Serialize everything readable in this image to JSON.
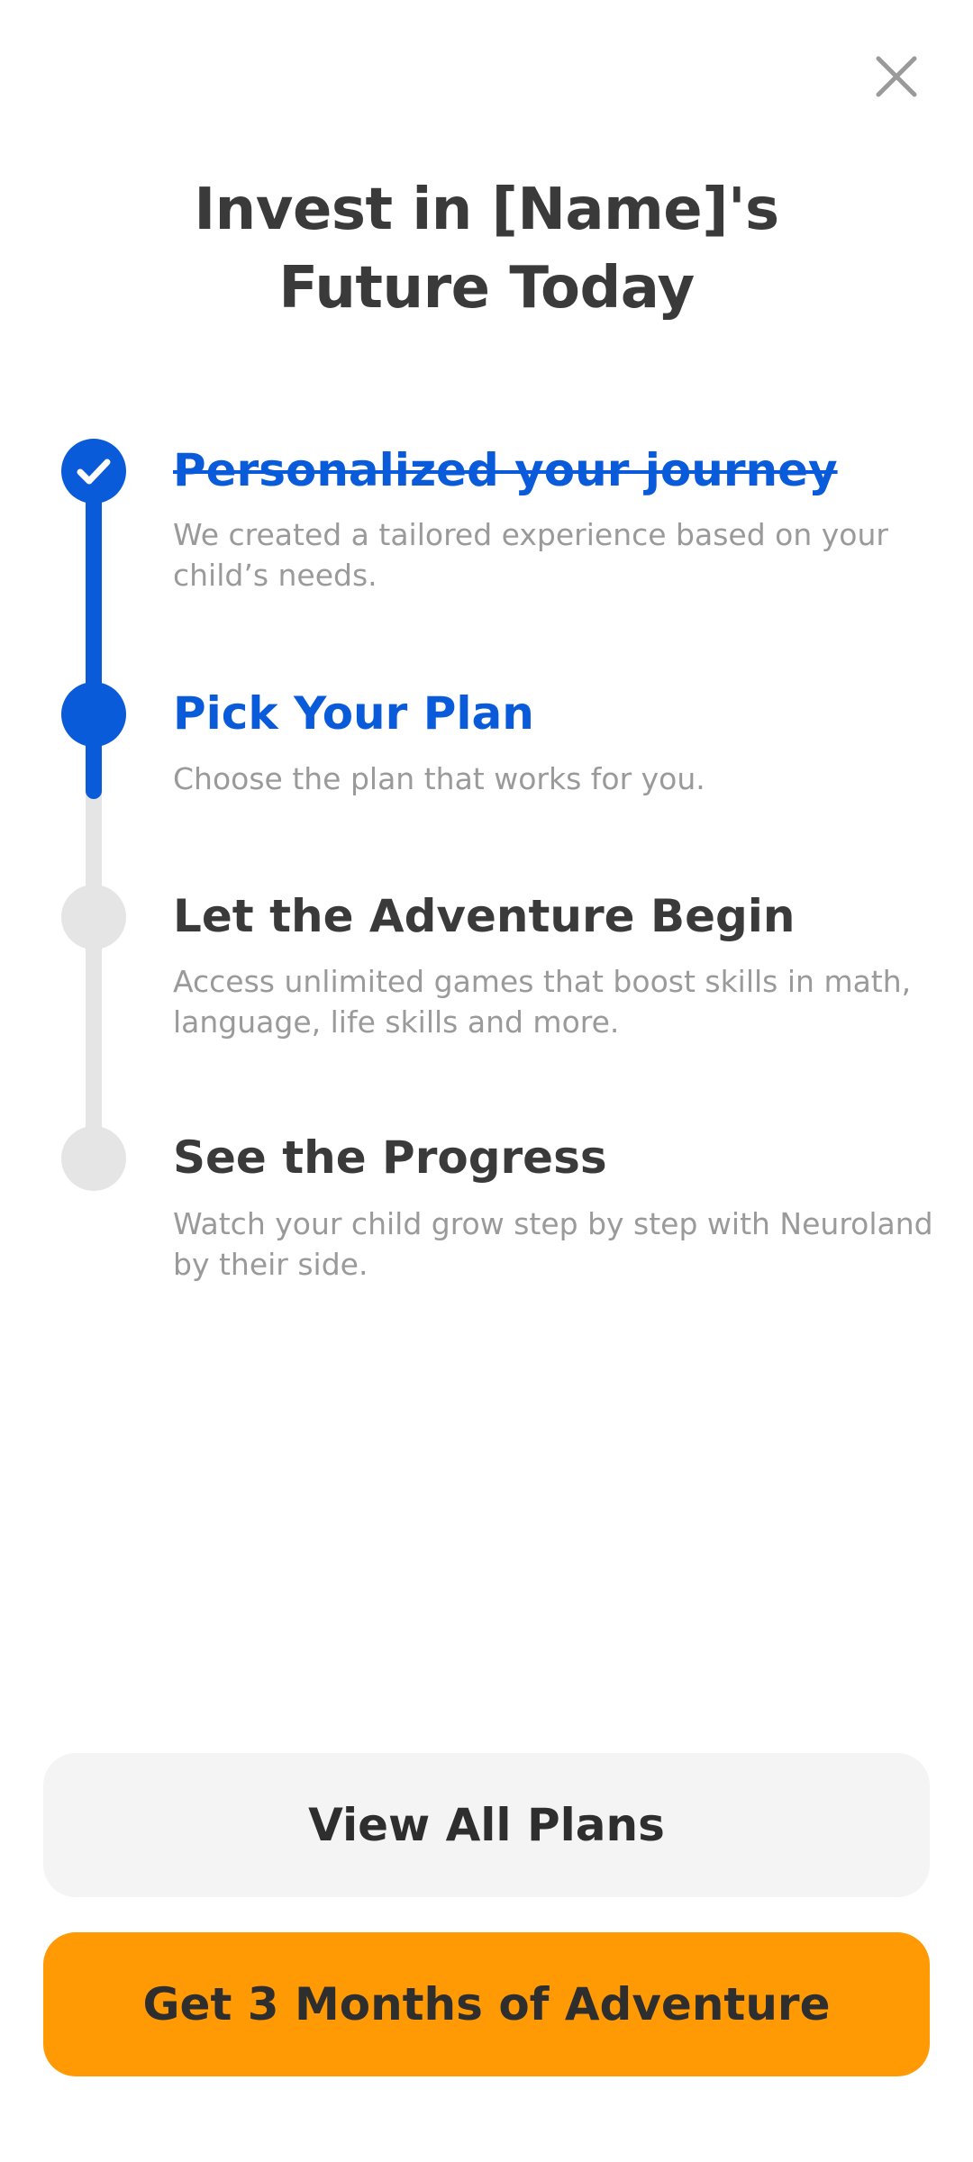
{
  "header": {
    "close_icon": "close-icon",
    "title_line1": "Invest in [Name]'s",
    "title_line2": "Future Today"
  },
  "colors": {
    "accent_blue": "#0a5bd9",
    "track_grey": "#e5e5e5",
    "primary_button": "#ff9a05",
    "secondary_button": "#f4f4f4"
  },
  "steps": [
    {
      "status": "completed",
      "icon": "check-icon",
      "title": "Personalized your journey",
      "description": "We created a tailored experience based on your child’s needs."
    },
    {
      "status": "current",
      "title": "Pick Your Plan",
      "description": "Choose the plan that works for you."
    },
    {
      "status": "upcoming",
      "title": "Let the Adventure Begin",
      "description": "Access unlimited games that boost skills in math, language, life skills and more."
    },
    {
      "status": "upcoming",
      "title": "See the Progress",
      "description": "Watch your child grow step by step with Neuroland by their side."
    }
  ],
  "actions": {
    "secondary_label": "View All Plans",
    "primary_label": "Get 3 Months of Adventure"
  }
}
